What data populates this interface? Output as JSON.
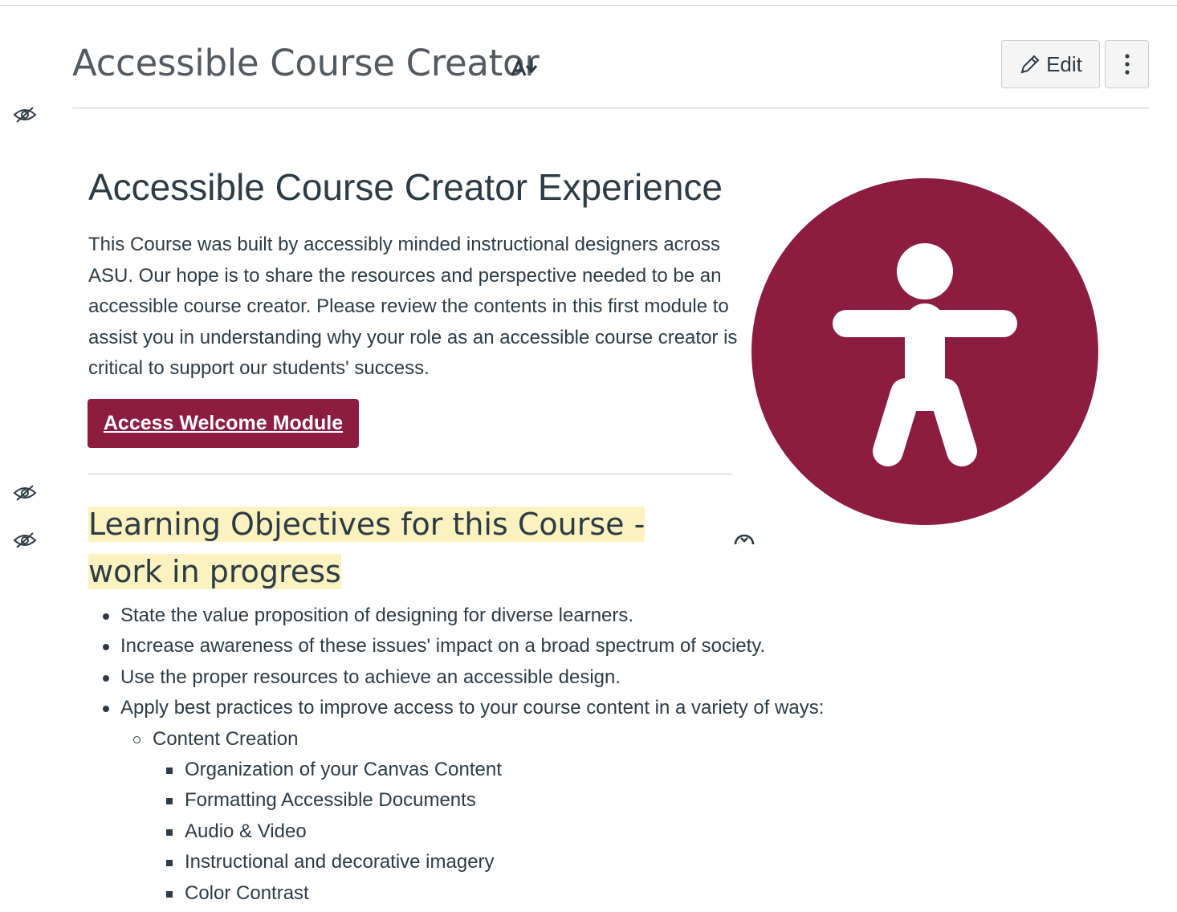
{
  "header": {
    "title": "Accessible Course Creator",
    "edit_label": "Edit"
  },
  "icons": {
    "translate": "translate-icon",
    "edit": "pencil-icon",
    "more": "kebab-menu-icon",
    "visibility": "eye-hidden-icon",
    "refresh": "refresh-icon"
  },
  "content": {
    "heading": "Accessible Course Creator Experience",
    "intro": "This Course was built by accessibly minded instructional designers across ASU. Our hope is to share the resources and perspective needed to be an accessible course creator. Please review the contents in this first module to assist you in understanding why your role as an accessible course creator is critical to support our students' success.",
    "welcome_button": "Access Welcome Module",
    "objectives_heading": "Learning Objectives for this Course - work in progress",
    "objectives": [
      "State the value proposition of designing for diverse learners.",
      "Increase awareness of these issues' impact on a broad spectrum of society.",
      "Use the proper resources to achieve an accessible design.",
      "Apply best practices to improve access to your course content in a variety of ways:"
    ],
    "sub_topic": "Content Creation",
    "sub_items": [
      "Organization of your Canvas Content",
      "Formatting Accessible Documents",
      "Audio & Video",
      "Instructional and decorative imagery",
      "Color Contrast"
    ]
  },
  "colors": {
    "brand_maroon": "#8c1d40",
    "highlight": "#fbf2c0",
    "text": "#2d3b45"
  }
}
